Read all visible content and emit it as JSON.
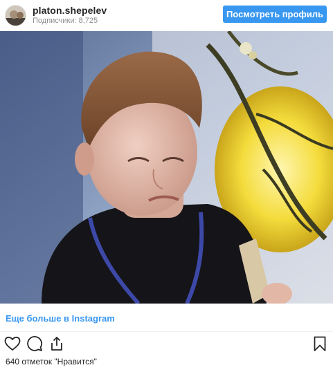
{
  "header": {
    "username": "platon.shepelev",
    "followers": "Подписчики: 8,725",
    "profile_button": "Посмотреть профиль"
  },
  "media": {
    "description_icon": "video-frame"
  },
  "footer": {
    "more_link": "Еще больше в Instagram",
    "likes": "640 отметок \"Нравится\""
  },
  "icons": [
    "heart-icon",
    "comment-icon",
    "share-icon",
    "bookmark-icon"
  ],
  "colors": {
    "accent": "#3897f0",
    "text": "#262626",
    "muted": "#8e8e8e"
  }
}
